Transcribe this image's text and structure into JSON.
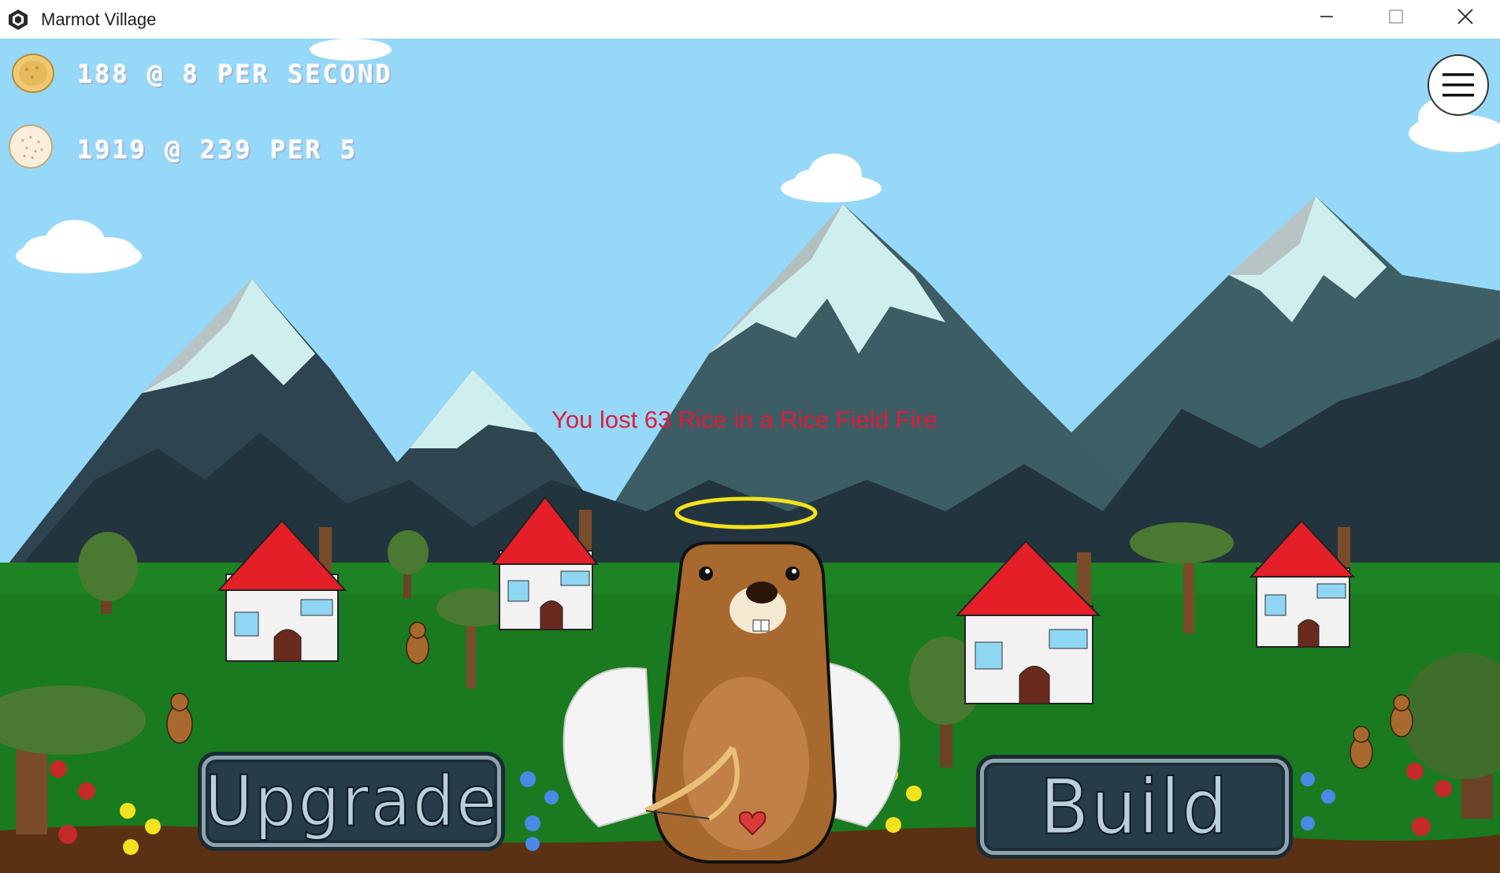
{
  "window": {
    "title": "Marmot Village",
    "icon": "unity-logo-icon"
  },
  "hud": {
    "bread": {
      "icon": "bread-icon",
      "text": "188 @ 8 PER SECOND"
    },
    "rice": {
      "icon": "rice-cake-icon",
      "text": "1919 @ 239 PER 5"
    }
  },
  "menu": {
    "icon": "hamburger-menu-icon"
  },
  "event_message": "You lost 63 Rice in a Rice Field Fire",
  "buttons": {
    "upgrade": "Upgrade",
    "build": "Build"
  },
  "colors": {
    "sky": "#96d8f8",
    "grass": "#1a7a1f",
    "dirt": "#5a3112",
    "roof": "#e41f27",
    "event_text": "#e01b3a",
    "button_bg": "#263c48",
    "button_text": "#b9d0dc"
  }
}
